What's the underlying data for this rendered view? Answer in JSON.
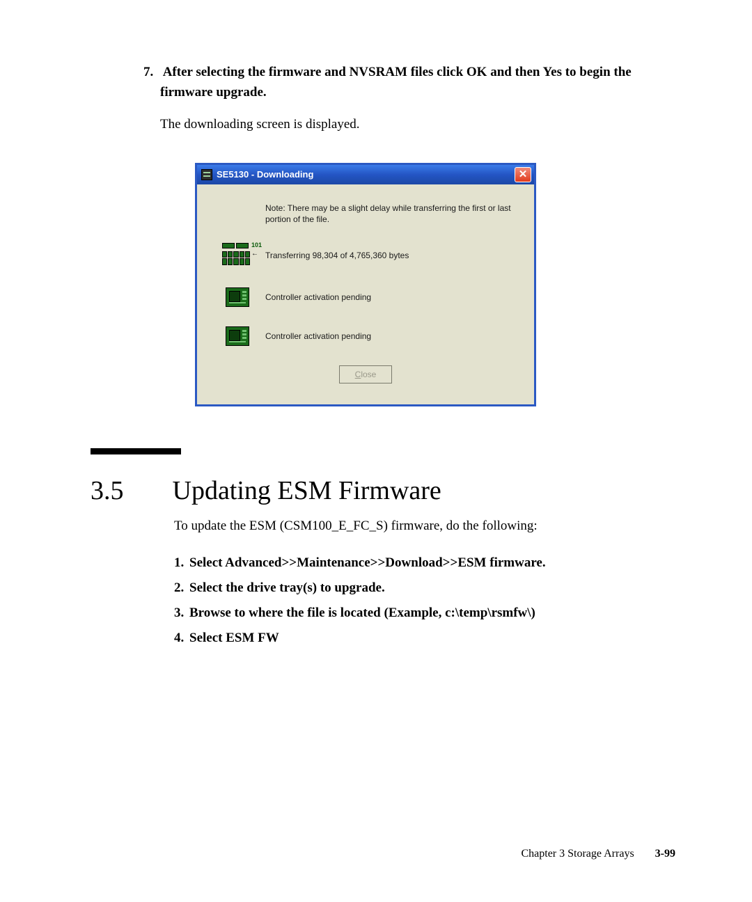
{
  "step7": {
    "number": "7.",
    "bold_text": "After selecting the firmware and NVSRAM files click OK and then Yes to begin the firmware upgrade.",
    "desc": "The downloading screen is displayed."
  },
  "dialog": {
    "title": "SE5130 - Downloading",
    "close_x": "✕",
    "note": "Note: There may be a slight delay while transferring the first or last portion of the file.",
    "transfer": {
      "label101": "101",
      "arrow": "←",
      "text": "Transferring 98,304 of 4,765,360 bytes"
    },
    "ctrl1": "Controller activation pending",
    "ctrl2": "Controller activation pending",
    "close_btn": "Close"
  },
  "section": {
    "number": "3.5",
    "title": "Updating ESM Firmware",
    "intro": "To update the ESM (CSM100_E_FC_S) firmware, do the following:",
    "steps": [
      "Select Advanced>>Maintenance>>Download>>ESM firmware.",
      "Select the drive tray(s) to upgrade.",
      "Browse to where the file is located (Example, c:\\temp\\rsmfw\\)",
      "Select ESM FW"
    ]
  },
  "footer": {
    "chapter": "Chapter 3   Storage Arrays",
    "page": "3-99"
  }
}
